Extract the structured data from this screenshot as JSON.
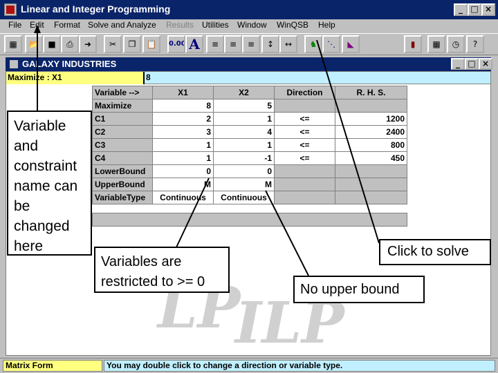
{
  "app": {
    "title": "Linear and Integer Programming",
    "icon_label": "WinQSB"
  },
  "window_buttons": [
    "_",
    "□",
    "×"
  ],
  "menu": [
    {
      "label": "File",
      "enabled": true
    },
    {
      "label": "Edit",
      "enabled": true
    },
    {
      "label": "Format",
      "enabled": true
    },
    {
      "label": "Solve and Analyze",
      "enabled": true
    },
    {
      "label": "Results",
      "enabled": false
    },
    {
      "label": "Utilities",
      "enabled": true
    },
    {
      "label": "Window",
      "enabled": true
    },
    {
      "label": "WinQSB",
      "enabled": true
    },
    {
      "label": "Help",
      "enabled": true
    }
  ],
  "toolbar": {
    "decimal_label": "0.00",
    "font_label": "A",
    "icons": [
      "grid-icon",
      "open-icon",
      "save-icon",
      "print-icon",
      "exit-icon",
      "cut-icon",
      "copy-icon",
      "paste-icon",
      "decimal-icon",
      "font-icon",
      "align-left-icon",
      "align-center-icon",
      "align-right-icon",
      "row-height-icon",
      "column-width-icon",
      "solve-icon",
      "graph-solve-icon",
      "chart-icon",
      "bar-chart-icon",
      "calculator-icon",
      "clock-icon",
      "help-icon"
    ]
  },
  "child_window": {
    "title": "GALAXY INDUSTRIES"
  },
  "formula_bar": {
    "cell_ref": "Maximize : X1",
    "cell_value": "8"
  },
  "grid": {
    "headers": [
      "Variable -->",
      "X1",
      "X2",
      "Direction",
      "R. H. S."
    ],
    "rows": [
      {
        "name": "Maximize",
        "x1": "8",
        "x2": "5",
        "direction": "",
        "rhs": ""
      },
      {
        "name": "C1",
        "x1": "2",
        "x2": "1",
        "direction": "<=",
        "rhs": "1200"
      },
      {
        "name": "C2",
        "x1": "3",
        "x2": "4",
        "direction": "<=",
        "rhs": "2400"
      },
      {
        "name": "C3",
        "x1": "1",
        "x2": "1",
        "direction": "<=",
        "rhs": "800"
      },
      {
        "name": "C4",
        "x1": "1",
        "x2": "-1",
        "direction": "<=",
        "rhs": "450"
      },
      {
        "name": "LowerBound",
        "x1": "0",
        "x2": "0",
        "direction": "",
        "rhs": ""
      },
      {
        "name": "UpperBound",
        "x1": "M",
        "x2": "M",
        "direction": "",
        "rhs": ""
      },
      {
        "name": "VariableType",
        "x1": "Continuous",
        "x2": "Continuous",
        "direction": "",
        "rhs": ""
      }
    ]
  },
  "watermark": {
    "lp": "LP",
    "ilp": "ILP"
  },
  "status": {
    "left": "Matrix Form",
    "right": "You may double click to change a direction or variable type."
  },
  "annotations": {
    "variable_names": "Variable and constraint name can be changed here",
    "restricted": "Variables are restricted to >= 0",
    "solve": "Click to solve",
    "upper_bound": "No upper bound"
  },
  "colors": {
    "title_bar": "#0a246a",
    "chrome": "#c0c0c0",
    "cell_ref_bg": "#ffff80",
    "formula_bg": "#c0f0ff"
  }
}
